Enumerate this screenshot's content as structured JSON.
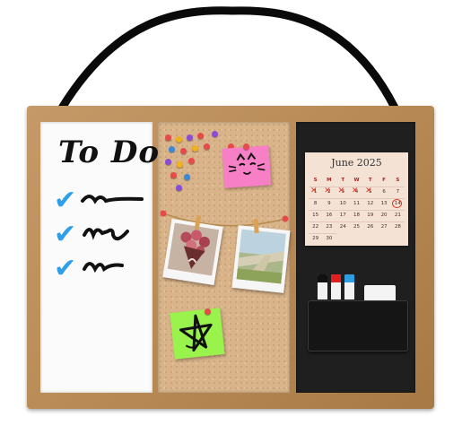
{
  "whiteboard": {
    "title": "To Do",
    "checks": [
      "✔",
      "✔",
      "✔"
    ]
  },
  "calendar": {
    "month": "June 2025",
    "weekdays": [
      "S",
      "M",
      "T",
      "W",
      "T",
      "F",
      "S"
    ],
    "days": [
      1,
      2,
      3,
      4,
      5,
      6,
      7,
      8,
      9,
      10,
      11,
      12,
      13,
      14,
      15,
      16,
      17,
      18,
      19,
      20,
      21,
      22,
      23,
      24,
      25,
      26,
      27,
      28,
      29,
      30
    ],
    "crossed": [
      1,
      2,
      3,
      4,
      5
    ],
    "circled": 14
  },
  "markers": {
    "colors": [
      "#111111",
      "#e02020",
      "#2f9ee0"
    ]
  },
  "colors": {
    "frame": "#b58752",
    "cork": "#d9b48a",
    "chalkboard": "#1f1f1f",
    "check": "#2e9fe8",
    "sticky_pink": "#f77fc5",
    "sticky_green": "#9af24c",
    "pins": [
      "#e64a4a",
      "#8a4cd6",
      "#f0b21c",
      "#3a8ad8"
    ]
  },
  "icons": {
    "strap": "hanging-strap-icon",
    "pink_note": "cat-face-doodle-icon",
    "green_note": "star-doodle-icon",
    "photo_left": "flower-bouquet-photo",
    "photo_right": "seaside-path-photo"
  }
}
